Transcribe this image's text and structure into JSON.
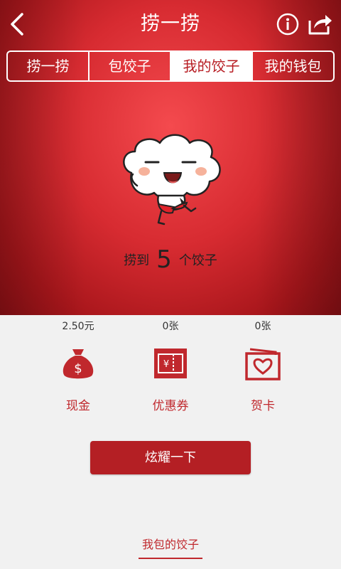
{
  "header": {
    "title": "捞一捞",
    "back_icon": "chevron-left-icon",
    "info_icon": "info-icon",
    "share_icon": "share-icon"
  },
  "tabs": [
    {
      "label": "捞一捞",
      "active": false
    },
    {
      "label": "包饺子",
      "active": false
    },
    {
      "label": "我的饺子",
      "active": true
    },
    {
      "label": "我的钱包",
      "active": false
    }
  ],
  "result": {
    "prefix": "捞到",
    "count": "5",
    "suffix": "个饺子"
  },
  "wallet": [
    {
      "value": "2.50元",
      "label": "现金",
      "icon": "money-bag-icon"
    },
    {
      "value": "0张",
      "label": "优惠券",
      "icon": "coupon-icon"
    },
    {
      "value": "0张",
      "label": "贺卡",
      "icon": "greeting-card-icon"
    }
  ],
  "actions": {
    "flaunt_label": "炫耀一下",
    "my_dumplings_label": "我包的饺子"
  },
  "colors": {
    "brand_red": "#b41f24",
    "text_red": "#c0282d"
  }
}
